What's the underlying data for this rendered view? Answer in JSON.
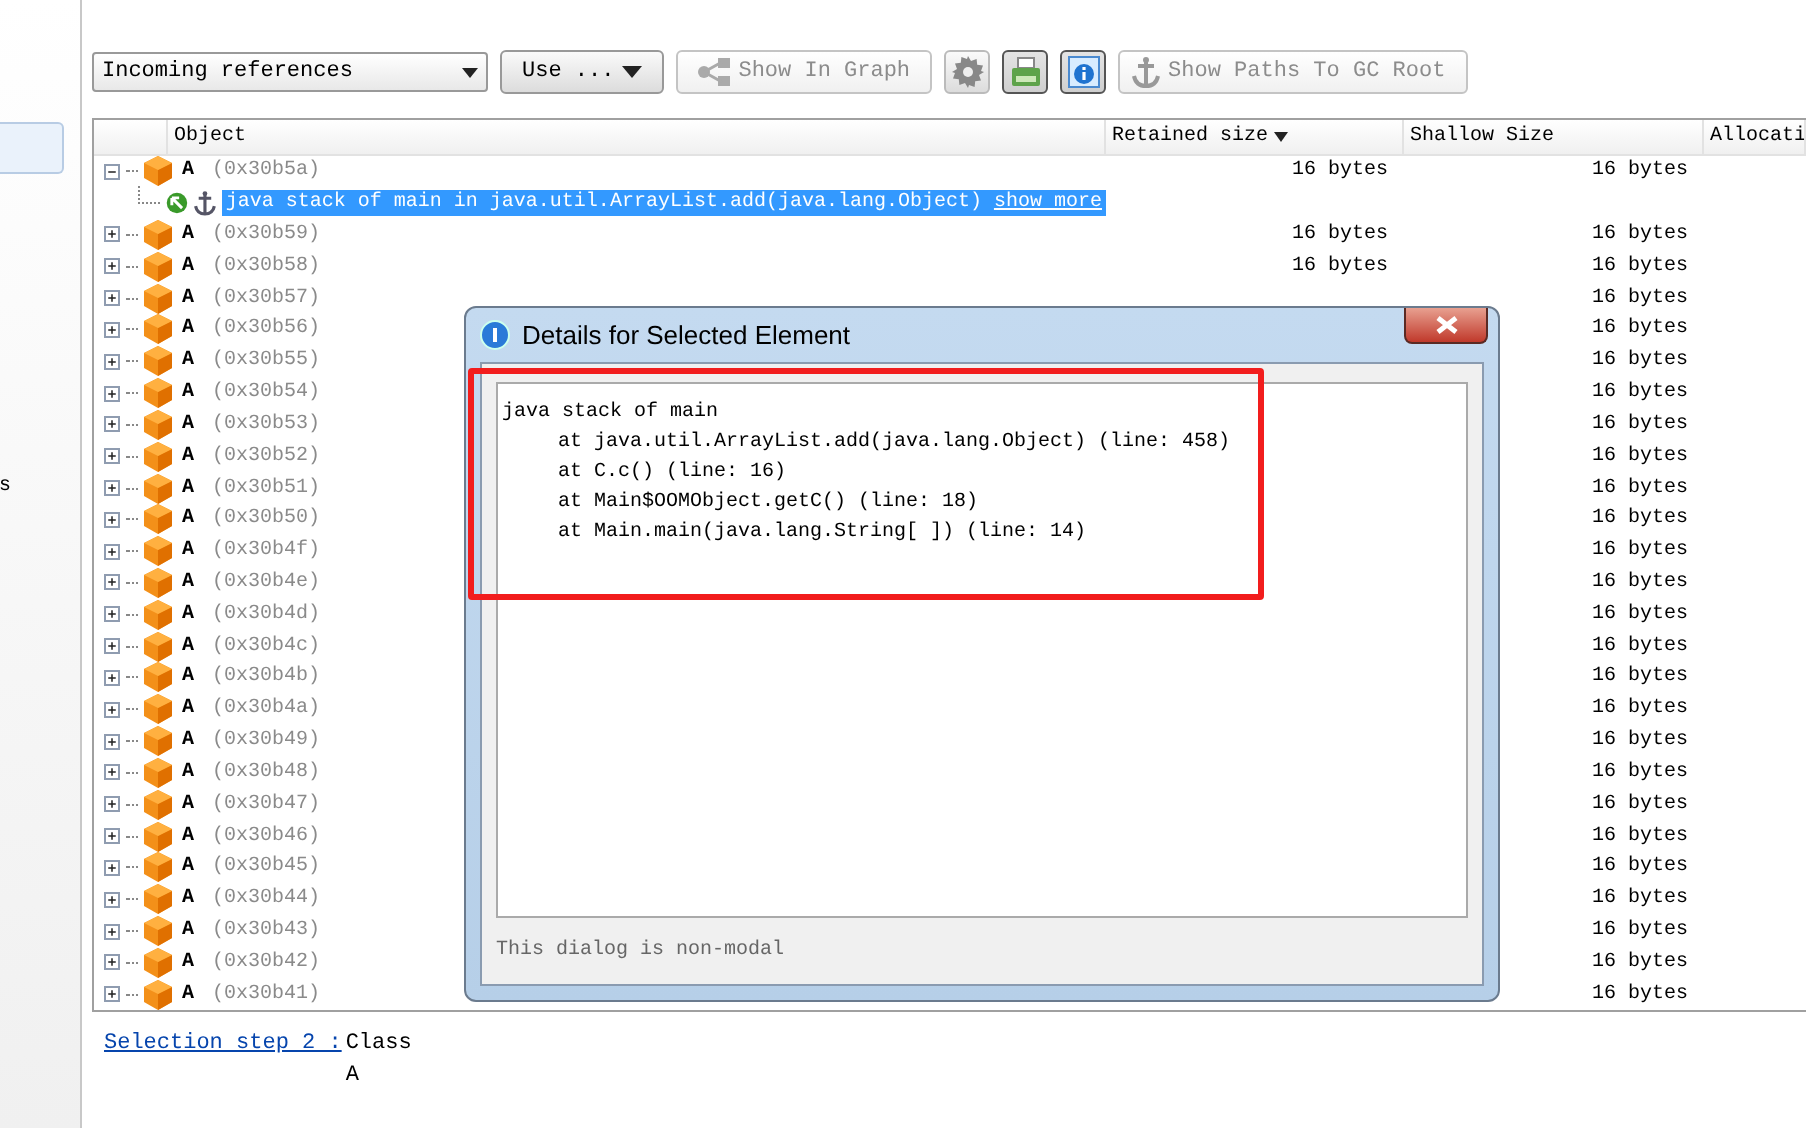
{
  "sidebar": {
    "items": [
      {
        "selected": true
      }
    ],
    "text": "s"
  },
  "toolbar": {
    "view_select": "Incoming references",
    "use_button": "Use ...",
    "buttons": [
      {
        "kind": "graph",
        "label": "Show In Graph",
        "disabled": true
      },
      {
        "kind": "gear",
        "selected": false
      },
      {
        "kind": "printer",
        "selected": true
      },
      {
        "kind": "info",
        "selected": true
      },
      {
        "kind": "anchor",
        "label": "Show Paths To GC Root",
        "disabled": true
      }
    ]
  },
  "table": {
    "columns": [
      {
        "label": "Object",
        "sorted": false
      },
      {
        "label": "Retained size",
        "sorted": true
      },
      {
        "label": "Shallow Size",
        "sorted": false
      },
      {
        "label": "Allocati"
      }
    ],
    "rows": [
      {
        "name": "A",
        "address": "(0x30b5a)",
        "expanded": true,
        "retained": "16 bytes",
        "shallow": "16 bytes",
        "children": [
          {
            "text": "java stack of main in java.util.ArrayList.add(java.lang.Object)",
            "link": "show more",
            "selected": true
          }
        ]
      },
      {
        "name": "A",
        "address": "(0x30b59)",
        "expanded": false,
        "retained": "16 bytes",
        "shallow": "16 bytes"
      },
      {
        "name": "A",
        "address": "(0x30b58)",
        "expanded": false,
        "retained": "16 bytes",
        "shallow": "16 bytes"
      },
      {
        "name": "A",
        "address": "(0x30b57)",
        "expanded": false,
        "shallow": "16 bytes"
      },
      {
        "name": "A",
        "address": "(0x30b56)",
        "expanded": false,
        "shallow": "16 bytes"
      },
      {
        "name": "A",
        "address": "(0x30b55)",
        "expanded": false,
        "shallow": "16 bytes"
      },
      {
        "name": "A",
        "address": "(0x30b54)",
        "expanded": false,
        "shallow": "16 bytes"
      },
      {
        "name": "A",
        "address": "(0x30b53)",
        "expanded": false,
        "shallow": "16 bytes"
      },
      {
        "name": "A",
        "address": "(0x30b52)",
        "expanded": false,
        "shallow": "16 bytes"
      },
      {
        "name": "A",
        "address": "(0x30b51)",
        "expanded": false,
        "shallow": "16 bytes"
      },
      {
        "name": "A",
        "address": "(0x30b50)",
        "expanded": false,
        "shallow": "16 bytes"
      },
      {
        "name": "A",
        "address": "(0x30b4f)",
        "expanded": false,
        "shallow": "16 bytes"
      },
      {
        "name": "A",
        "address": "(0x30b4e)",
        "expanded": false,
        "shallow": "16 bytes"
      },
      {
        "name": "A",
        "address": "(0x30b4d)",
        "expanded": false,
        "shallow": "16 bytes"
      },
      {
        "name": "A",
        "address": "(0x30b4c)",
        "expanded": false,
        "shallow": "16 bytes"
      },
      {
        "name": "A",
        "address": "(0x30b4b)",
        "expanded": false,
        "shallow": "16 bytes"
      },
      {
        "name": "A",
        "address": "(0x30b4a)",
        "expanded": false,
        "shallow": "16 bytes"
      },
      {
        "name": "A",
        "address": "(0x30b49)",
        "expanded": false,
        "shallow": "16 bytes"
      },
      {
        "name": "A",
        "address": "(0x30b48)",
        "expanded": false,
        "shallow": "16 bytes"
      },
      {
        "name": "A",
        "address": "(0x30b47)",
        "expanded": false,
        "shallow": "16 bytes"
      },
      {
        "name": "A",
        "address": "(0x30b46)",
        "expanded": false,
        "shallow": "16 bytes"
      },
      {
        "name": "A",
        "address": "(0x30b45)",
        "expanded": false,
        "shallow": "16 bytes"
      },
      {
        "name": "A",
        "address": "(0x30b44)",
        "expanded": false,
        "shallow": "16 bytes"
      },
      {
        "name": "A",
        "address": "(0x30b43)",
        "expanded": false,
        "shallow": "16 bytes"
      },
      {
        "name": "A",
        "address": "(0x30b42)",
        "expanded": false,
        "shallow": "16 bytes"
      },
      {
        "name": "A",
        "address": "(0x30b41)",
        "expanded": false,
        "shallow": "16 bytes"
      }
    ]
  },
  "dialog": {
    "title": "Details for Selected Element",
    "header": "java stack of main",
    "frames": [
      "at java.util.ArrayList.add(java.lang.Object) (line: 458)",
      "at C.c() (line: 16)",
      "at Main$OOMObject.getC() (line: 18)",
      "at Main.main(java.lang.String[ ]) (line: 14)"
    ],
    "highlighted": true,
    "footer": "This dialog is non-modal"
  },
  "selection": {
    "link": "Selection step 2 :",
    "label": "Class",
    "value": "A"
  }
}
